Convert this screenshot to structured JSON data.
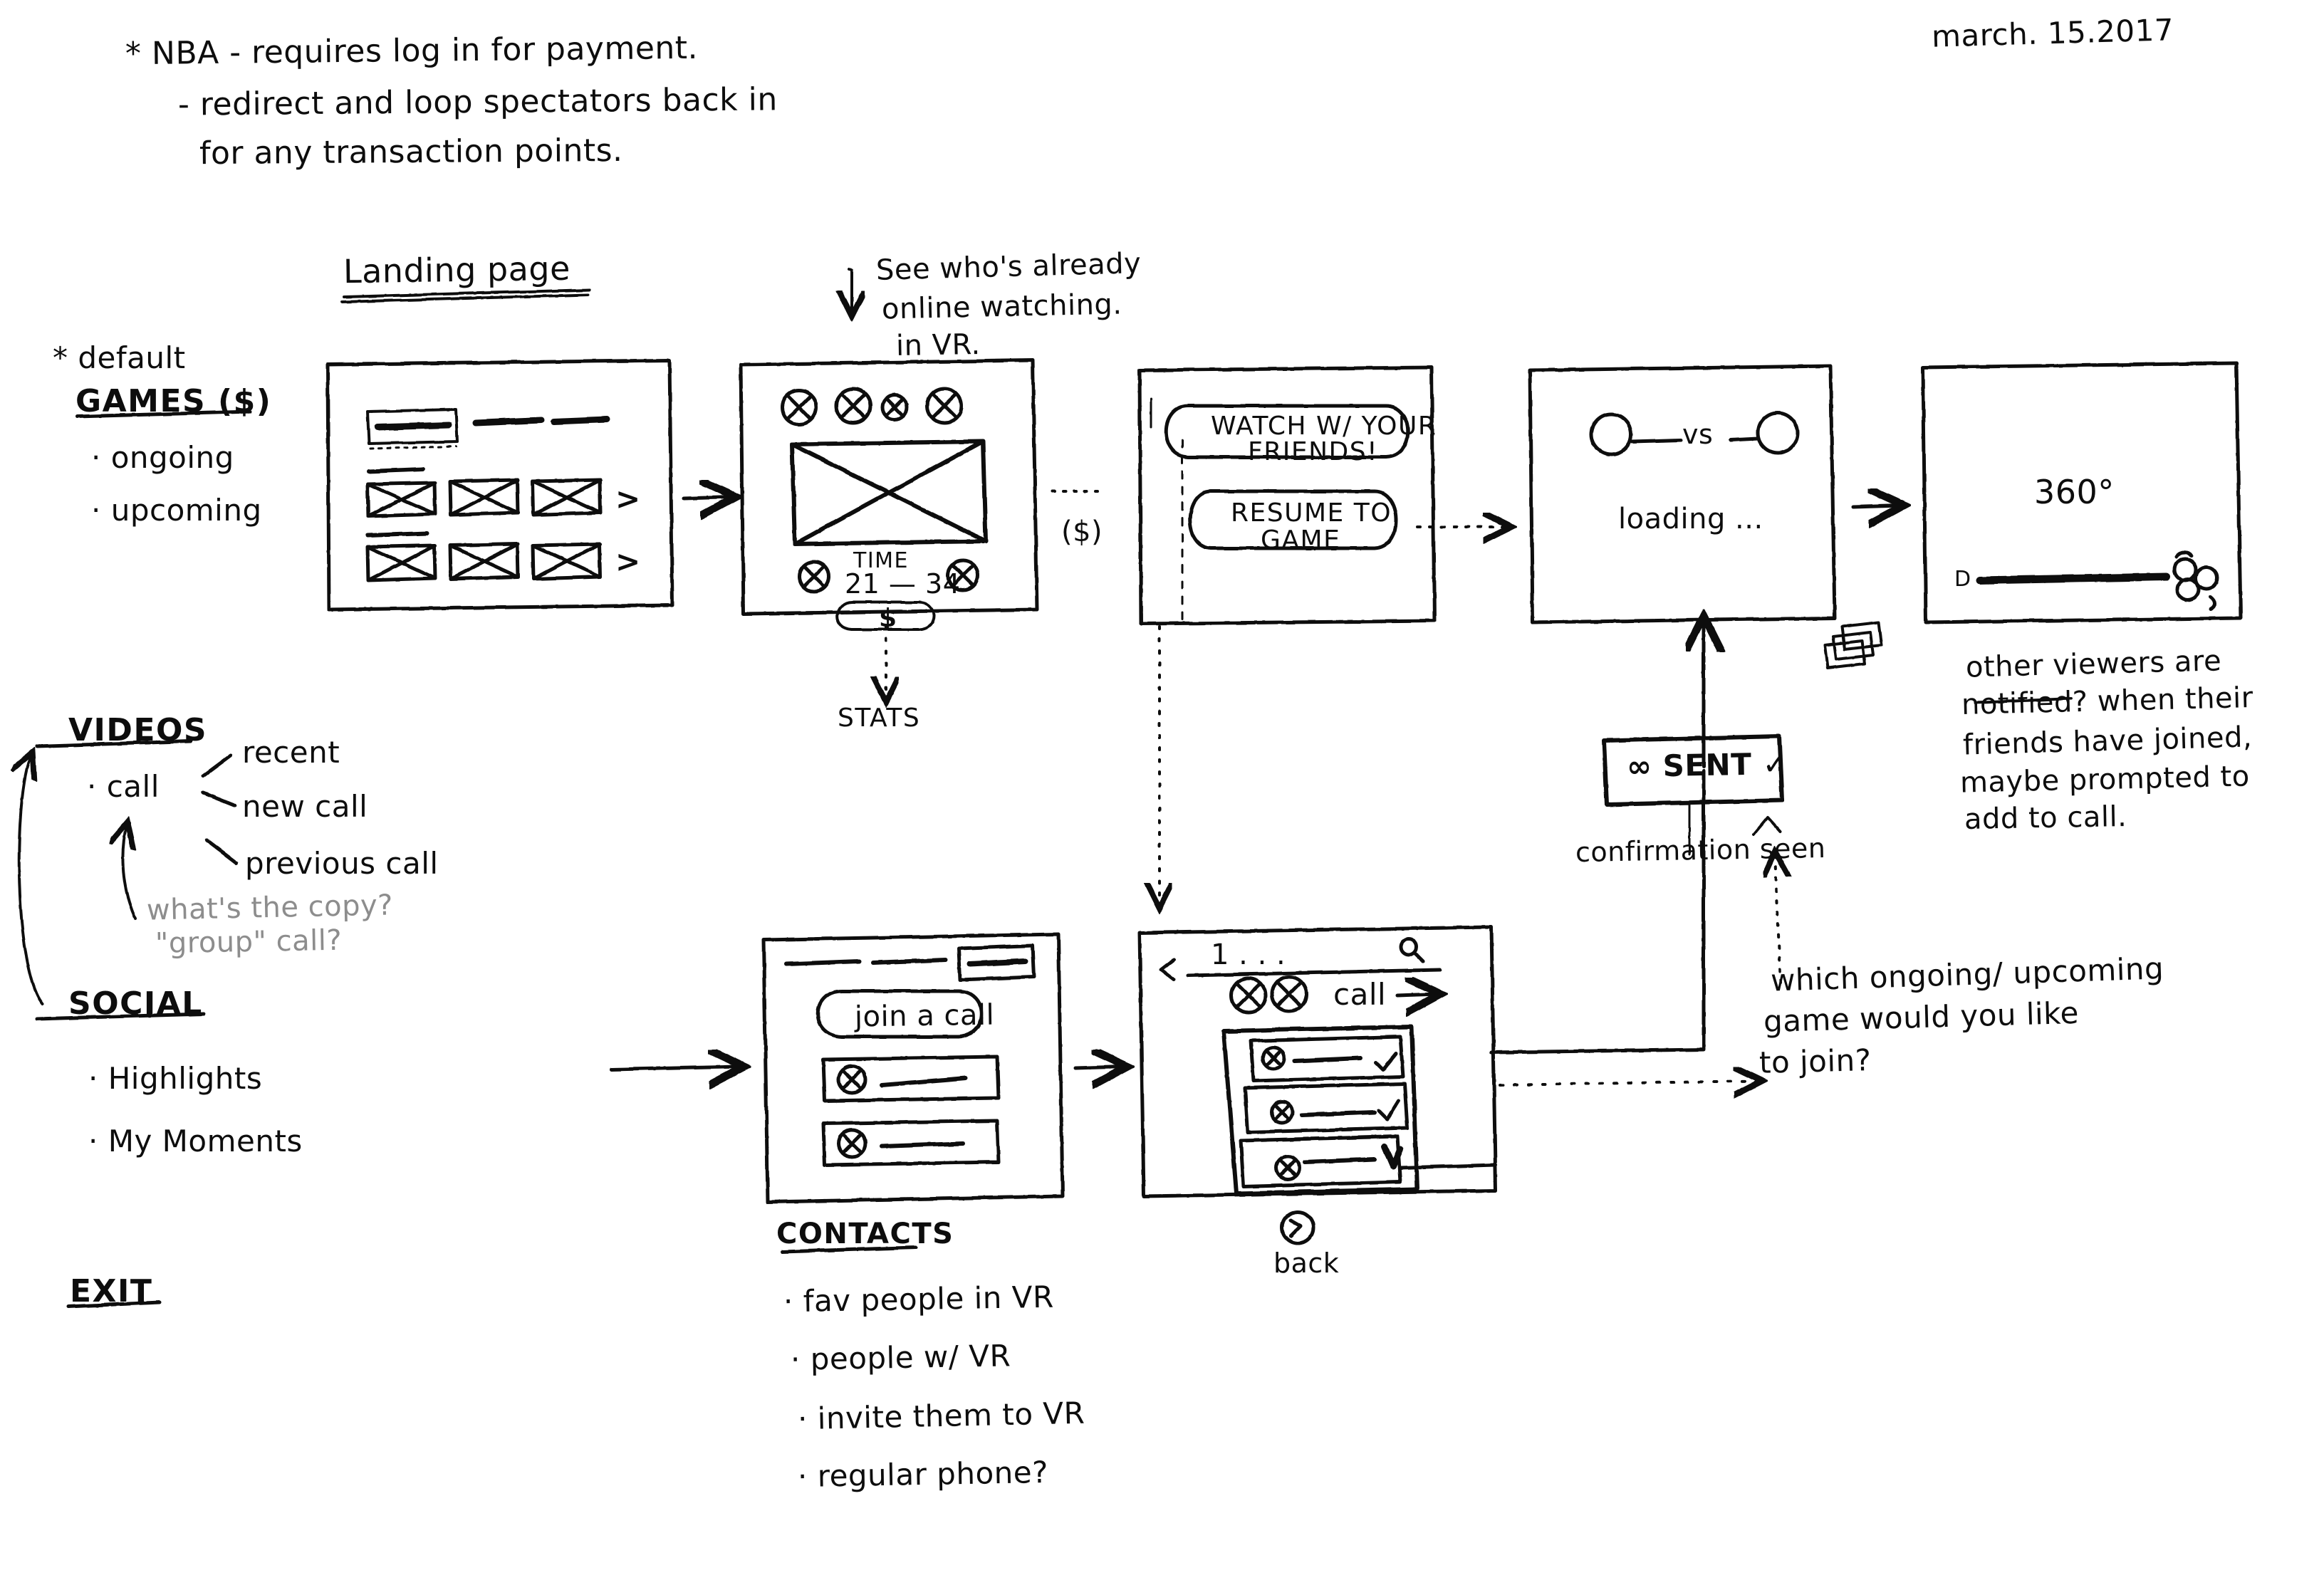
{
  "meta": {
    "date": "march. 15.2017",
    "ink_color": "#0d0d0d",
    "pencil_color": "#8d8d8d",
    "paper_color": "#ffffff"
  },
  "header_notes": {
    "line1": "* NBA - requires log in for payment.",
    "line2": "- redirect and loop spectators back in",
    "line3": "for any transaction points."
  },
  "sidebar": {
    "games": {
      "star_note": "* default",
      "title": "GAMES ($)",
      "items": [
        "· ongoing",
        "· upcoming"
      ]
    },
    "videos": {
      "title": "VIDEOS",
      "parent": "· call",
      "branches": [
        "recent",
        "new call",
        "previous call"
      ],
      "pencil_note_line1": "what's the copy?",
      "pencil_note_line2": "\"group\" call?"
    },
    "social": {
      "title": "SOCIAL",
      "items": [
        "· Highlights",
        "· My Moments"
      ]
    },
    "exit": {
      "title": "EXIT"
    }
  },
  "frames": {
    "landing": {
      "label": "Landing page",
      "caret_row1": ">",
      "caret_row2": ">"
    },
    "vr_watch": {
      "annotation_line1": "See who's already",
      "annotation_line2": "online watching.",
      "annotation_line3": "in VR.",
      "time_label": "TIME",
      "time_value": "21 — 34",
      "pill_label": "$",
      "stats_label": "STATS",
      "money_marker": "($)"
    },
    "prompt": {
      "cta_primary_line1": "WATCH W/ YOUR",
      "cta_primary_line2": "FRIENDS!",
      "cta_secondary_line1": "RESUME TO",
      "cta_secondary_line2": "GAME"
    },
    "loading": {
      "vs_label": "vs",
      "status": "loading ..."
    },
    "three_sixty": {
      "title": "360°",
      "left_marker": "D"
    },
    "join_call": {
      "pill_label": "join a call"
    },
    "contacts_list": {
      "back_chevron": "<",
      "title_placeholder": "1 . . .",
      "search_icon": "search-icon",
      "call_label": "call",
      "call_arrow": "→",
      "check1": "✓",
      "check2": "✓",
      "back_label": "back",
      "back_icon": "↰"
    }
  },
  "annotations": {
    "sent_badge": "∞ SENT ✓",
    "confirmation": "confirmation seen",
    "other_viewers_line1": "other viewers are",
    "other_viewers_line2": "notified? when their",
    "other_viewers_line3": "friends have joined,",
    "other_viewers_line4": "maybe prompted to",
    "other_viewers_line5": "add to call.",
    "which_game_line1": "which ongoing/ upcoming",
    "which_game_line2": "game would you like",
    "which_game_line3": "to join?",
    "contacts_title": "CONTACTS",
    "contacts_items": [
      "· fav people in VR",
      "· people w/ VR",
      "· invite them to VR",
      "· regular phone?"
    ]
  }
}
